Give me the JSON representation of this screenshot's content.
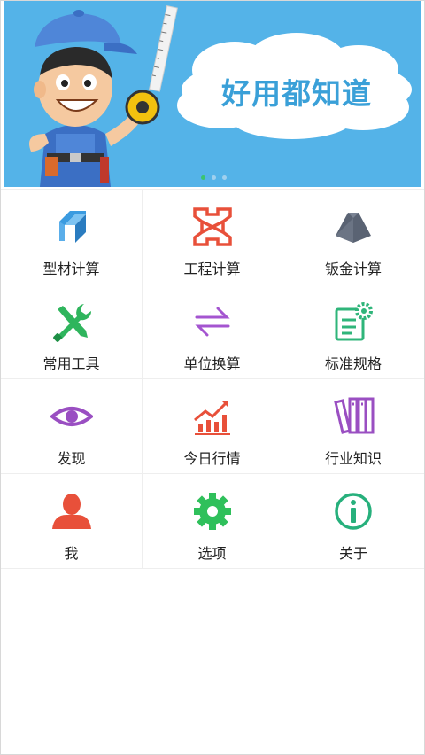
{
  "banner": {
    "slogan": "好用都知道",
    "page_count": 3,
    "active_page": 1
  },
  "menu": [
    {
      "label": "型材计算",
      "icon": "profile-beam-icon",
      "color": "#3b9be0"
    },
    {
      "label": "工程计算",
      "icon": "engineering-truss-icon",
      "color": "#e8503a"
    },
    {
      "label": "钣金计算",
      "icon": "sheet-metal-icon",
      "color": "#5a6373"
    },
    {
      "label": "常用工具",
      "icon": "wrench-screwdriver-icon",
      "color": "#2fb55d"
    },
    {
      "label": "单位换算",
      "icon": "convert-arrows-icon",
      "color": "#a455d0"
    },
    {
      "label": "标准规格",
      "icon": "spec-document-gear-icon",
      "color": "#2fb57a"
    },
    {
      "label": "发现",
      "icon": "eye-icon",
      "color": "#9a4fc2"
    },
    {
      "label": "今日行情",
      "icon": "market-chart-icon",
      "color": "#e8503a"
    },
    {
      "label": "行业知识",
      "icon": "books-icon",
      "color": "#9a4fc2"
    },
    {
      "label": "我",
      "icon": "user-icon",
      "color": "#e8503a"
    },
    {
      "label": "选项",
      "icon": "gear-icon",
      "color": "#2fc05b"
    },
    {
      "label": "关于",
      "icon": "info-icon",
      "color": "#27b07c"
    }
  ]
}
